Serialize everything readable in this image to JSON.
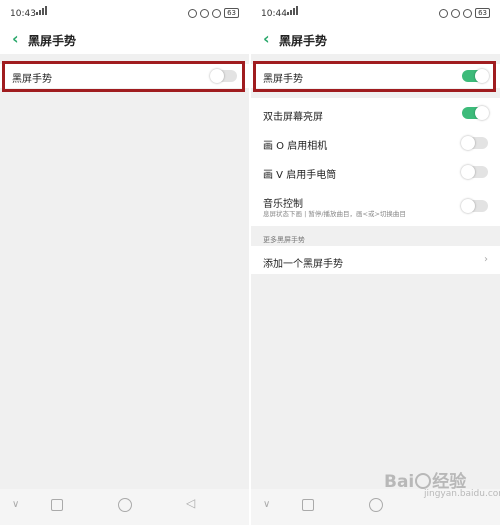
{
  "left": {
    "status": {
      "time": "10:43",
      "battery": "63"
    },
    "title": "黑屏手势",
    "gesture_row": {
      "label": "黑屏手势",
      "state": "off"
    }
  },
  "right": {
    "status": {
      "time": "10:44",
      "battery": "63"
    },
    "title": "黑屏手势",
    "gesture_row": {
      "label": "黑屏手势",
      "state": "on"
    },
    "options": [
      {
        "label": "双击屏幕亮屏",
        "state": "on"
      },
      {
        "label": "画 O 启用相机",
        "state": "off"
      },
      {
        "label": "画 V 启用手电筒",
        "state": "off"
      },
      {
        "label": "音乐控制",
        "sub": "息屏状态下画 | 暂停/播放曲目，画<或>切换曲目",
        "state": "off"
      }
    ],
    "section_title": "更多黑屏手势",
    "add_row": {
      "label": "添加一个黑屏手势"
    }
  },
  "watermark": {
    "brand": "Bai",
    "brand_suffix": "经验",
    "sub": "jingyan.baidu.com"
  },
  "colors": {
    "accent_green": "#3dbb7a",
    "highlight_red": "#a01c1f"
  }
}
